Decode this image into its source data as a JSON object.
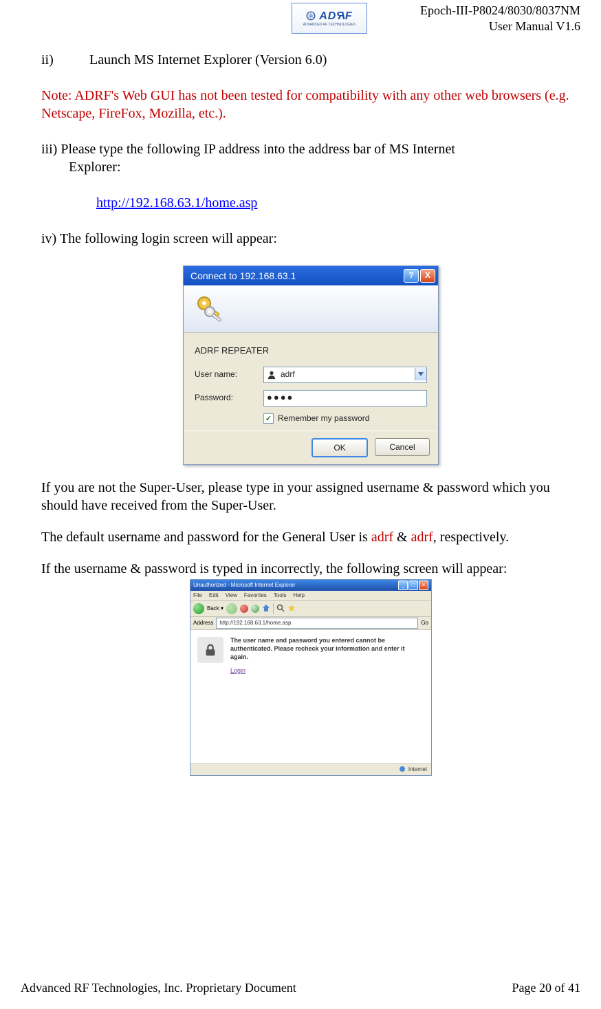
{
  "header": {
    "logo_text": "ADRF",
    "product": "Epoch-III-P8024/8030/8037NM",
    "manual": "User Manual V1.6"
  },
  "body": {
    "ii_num": "ii)",
    "ii_text": "Launch MS Internet Explorer (Version 6.0)",
    "note": "Note: ADRF's Web GUI has not been tested for compatibility with any other web browsers (e.g. Netscape, FireFox, Mozilla, etc.).",
    "iii_line1": "iii) Please type the following IP address into the address bar of MS Internet",
    "iii_line2": "Explorer:",
    "url": "http://192.168.63.1/home.asp",
    "iv": "iv) The following login screen will appear:",
    "after_dialog_p1": "If you are not the Super-User, please type in your assigned username & password which you should have received from the Super-User.",
    "creds_prefix": "The default username and password for the General User is ",
    "creds_user": "adrf",
    "creds_amp": " & ",
    "creds_pass": "adrf",
    "creds_suffix": ", respectively.",
    "wrong_login": "If the username & password is typed in incorrectly, the following screen will appear:"
  },
  "dialog": {
    "title": "Connect to 192.168.63.1",
    "realm": "ADRF REPEATER",
    "user_label": "User name:",
    "user_value": "adrf",
    "pass_label": "Password:",
    "pass_value": "●●●●",
    "remember": "Remember my password",
    "ok": "OK",
    "cancel": "Cancel"
  },
  "ie": {
    "title": "Unauthorized - Microsoft Internet Explorer",
    "menu": [
      "File",
      "Edit",
      "View",
      "Favorites",
      "Tools",
      "Help"
    ],
    "addr_label": "Address",
    "addr_value": "http://192.168.63.1/home.asp",
    "go": "Go",
    "error_text": "The user name and password you entered cannot be authenticated. Please recheck your information and enter it again.",
    "login_link": "Login",
    "status": "Internet"
  },
  "footer": {
    "left": "Advanced RF Technologies, Inc. Proprietary Document",
    "right": "Page 20 of 41"
  }
}
